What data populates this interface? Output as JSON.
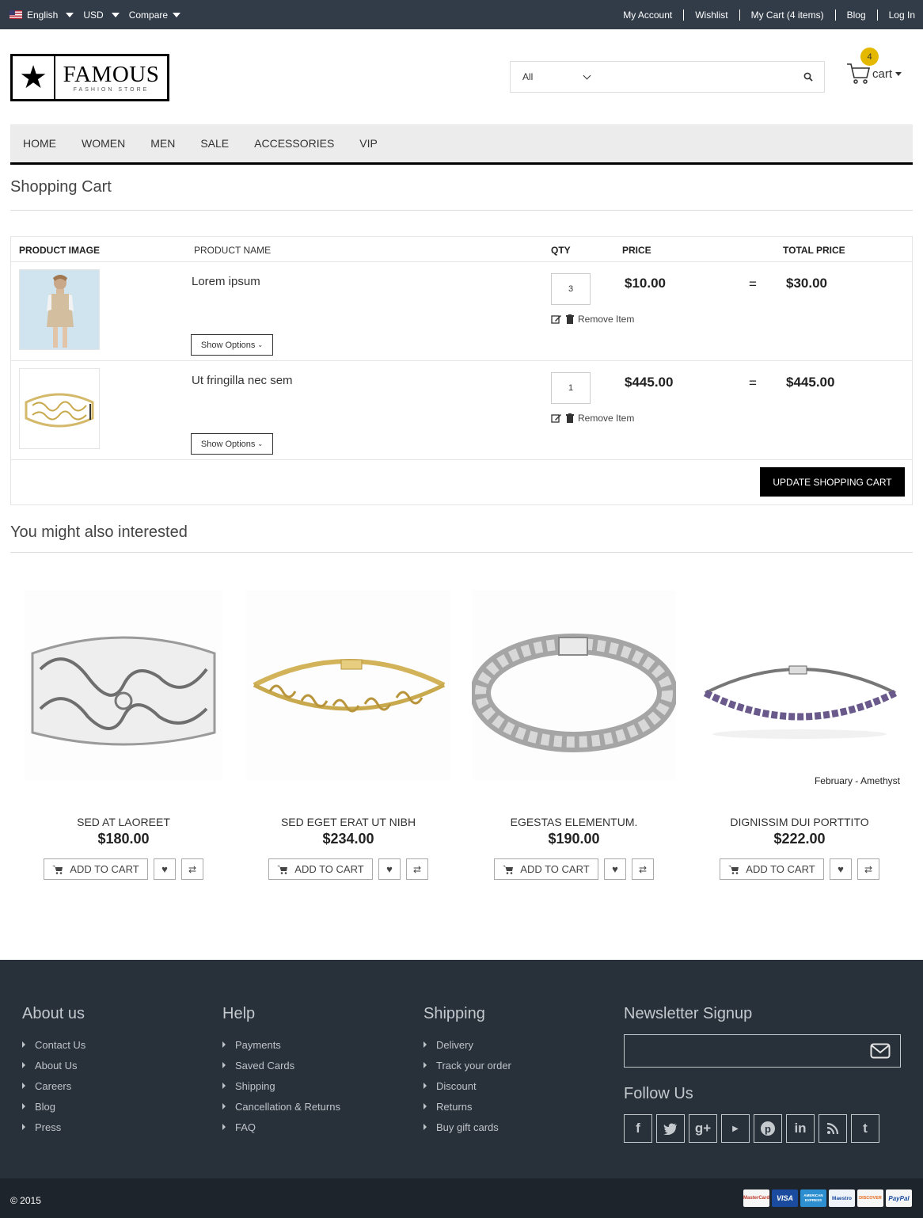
{
  "topbar": {
    "language": "English",
    "currency": "USD",
    "compare": "Compare",
    "links": [
      "My Account",
      "Wishlist",
      "My Cart (4 items)",
      "Blog",
      "Log In"
    ]
  },
  "header": {
    "logo_name": "FAMOUS",
    "logo_sub": "FASHION STORE",
    "search": {
      "category": "All",
      "placeholder": ""
    },
    "cart": {
      "count": "4",
      "label": "cart"
    }
  },
  "nav": [
    "HOME",
    "WOMEN",
    "MEN",
    "SALE",
    "ACCESSORIES",
    "VIP"
  ],
  "page_title": "Shopping Cart",
  "cart_table": {
    "headers": {
      "image": "PRODUCT IMAGE",
      "name": "PRODUCT NAME",
      "qty": "QTY",
      "price": "PRICE",
      "total": "TOTAL PRICE"
    },
    "rows": [
      {
        "name": "Lorem ipsum",
        "qty": "3",
        "price": "$10.00",
        "eq": "=",
        "total": "$30.00",
        "options": "Show Options",
        "remove": "Remove Item"
      },
      {
        "name": "Ut fringilla nec sem",
        "qty": "1",
        "price": "$445.00",
        "eq": "=",
        "total": "$445.00",
        "options": "Show Options",
        "remove": "Remove Item"
      }
    ],
    "update_label": "UPDATE SHOPPING CART"
  },
  "interested": {
    "title": "You might also interested",
    "products": [
      {
        "name": "SED AT LAOREET",
        "price": "$180.00",
        "add": "ADD TO CART"
      },
      {
        "name": "SED EGET ERAT UT NIBH",
        "price": "$234.00",
        "add": "ADD TO CART"
      },
      {
        "name": "EGESTAS ELEMENTUM.",
        "price": "$190.00",
        "add": "ADD TO CART"
      },
      {
        "name": "DIGNISSIM DUI PORTTITO",
        "price": "$222.00",
        "add": "ADD TO CART",
        "caption": "February - Amethyst"
      }
    ]
  },
  "footer": {
    "about": {
      "title": "About us",
      "items": [
        "Contact Us",
        "About Us",
        "Careers",
        "Blog",
        "Press"
      ]
    },
    "help": {
      "title": "Help",
      "items": [
        "Payments",
        "Saved Cards",
        "Shipping",
        "Cancellation & Returns",
        "FAQ"
      ]
    },
    "shipping": {
      "title": "Shipping",
      "items": [
        "Delivery",
        "Track your order",
        "Discount",
        "Returns",
        "Buy gift cards"
      ]
    },
    "newsletter": {
      "title": "Newsletter Signup",
      "placeholder": ""
    },
    "follow": {
      "title": "Follow Us",
      "icons": [
        "facebook-icon",
        "twitter-icon",
        "google-plus-icon",
        "youtube-icon",
        "pinterest-icon",
        "linkedin-icon",
        "rss-icon",
        "tumblr-icon"
      ]
    },
    "copyright": "© 2015",
    "payments": [
      "MasterCard",
      "VISA",
      "AMERICAN EXPRESS",
      "Maestro",
      "DISCOVER",
      "PayPal"
    ]
  },
  "colors": {
    "topbar_bg": "#323c48",
    "footer_bg": "#283039",
    "bottombar_bg": "#1e242b",
    "cart_badge": "#e5b800",
    "nav_bg": "#ececec"
  }
}
